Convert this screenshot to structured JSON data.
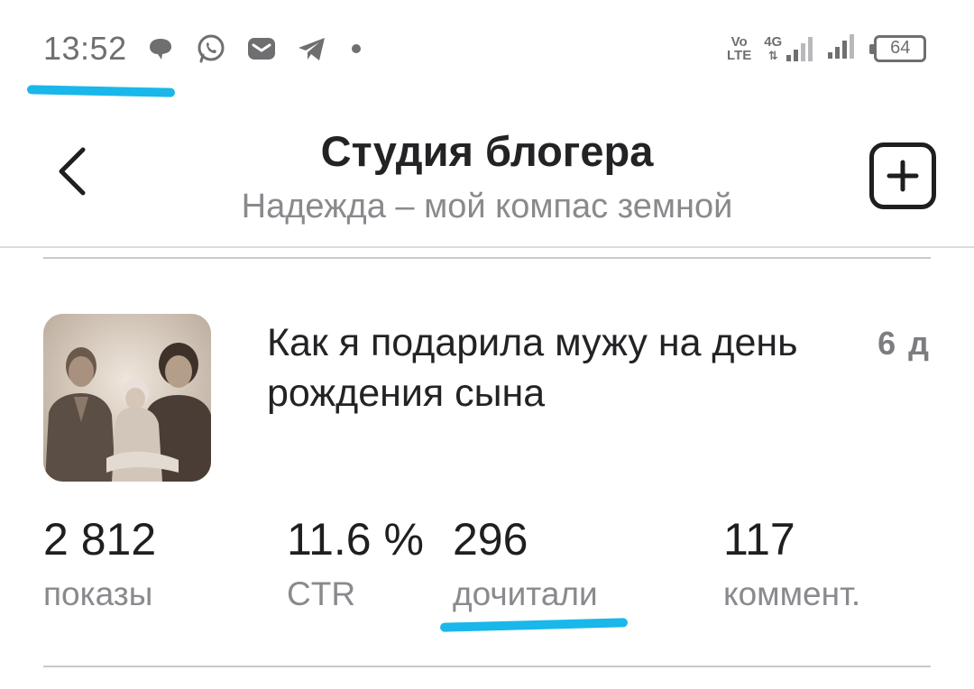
{
  "status_bar": {
    "time": "13:52",
    "network_label_top": "Vo",
    "network_label_bottom": "LTE",
    "network_type": "4G",
    "battery": "64",
    "icons": [
      "chat-bubble-icon",
      "whatsapp-icon",
      "mail-icon",
      "telegram-icon",
      "notification-dot-icon",
      "volte-icon",
      "signal-4g-icon",
      "signal-icon",
      "battery-icon"
    ]
  },
  "header": {
    "title": "Студия блогера",
    "subtitle": "Надежда – мой компас земной",
    "back_icon": "chevron-left-icon",
    "add_icon": "plus-square-icon"
  },
  "article": {
    "title": "Как я подарила мужу на день рождения сына",
    "age": "6 д",
    "stats": [
      {
        "value": "2 812",
        "label": "показы"
      },
      {
        "value": "11.6 %",
        "label": "CTR"
      },
      {
        "value": "296",
        "label": "дочитали"
      },
      {
        "value": "117",
        "label": "коммент."
      }
    ]
  },
  "colors": {
    "highlight": "#1ab7ea",
    "text_primary": "#1f1f21",
    "text_secondary": "#8a8a8e",
    "divider": "#c9c9cc"
  }
}
